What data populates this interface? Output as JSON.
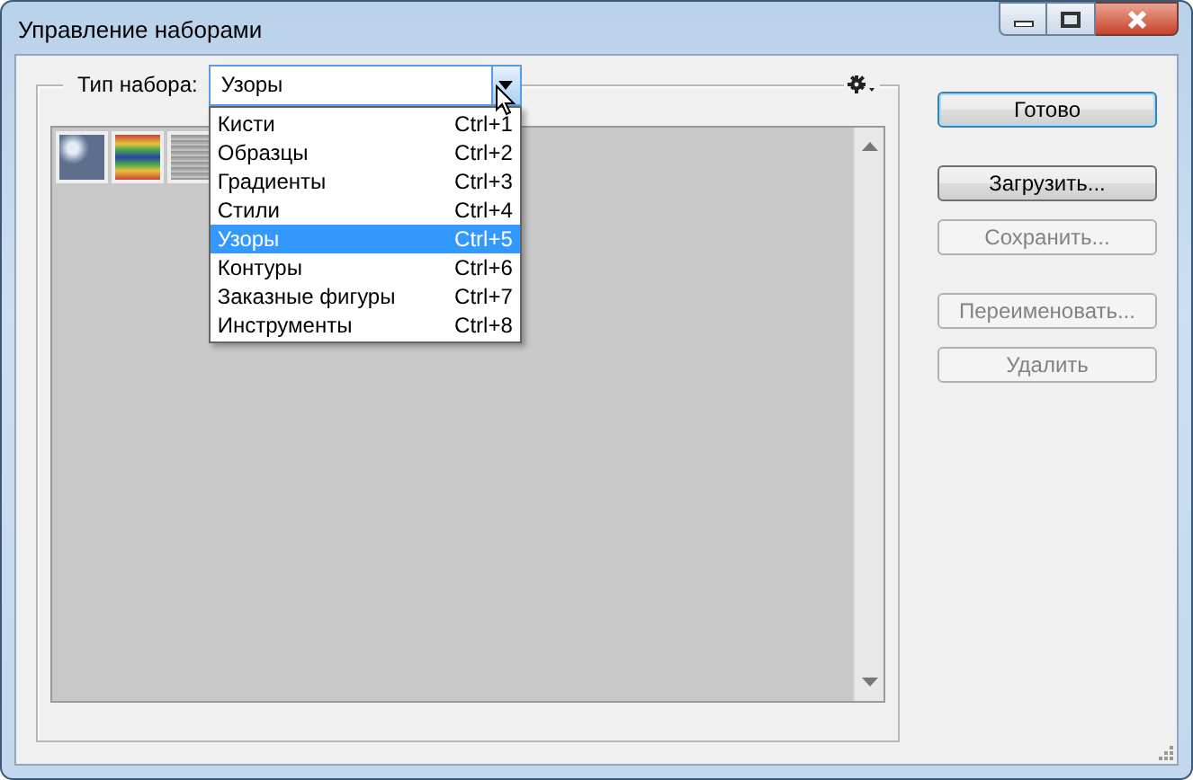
{
  "window": {
    "title": "Управление наборами"
  },
  "preset_type": {
    "label": "Тип набора:",
    "value": "Узоры",
    "expanded": true
  },
  "menu_items": [
    {
      "label": "Кисти",
      "shortcut": "Ctrl+1",
      "selected": false
    },
    {
      "label": "Образцы",
      "shortcut": "Ctrl+2",
      "selected": false
    },
    {
      "label": "Градиенты",
      "shortcut": "Ctrl+3",
      "selected": false
    },
    {
      "label": "Стили",
      "shortcut": "Ctrl+4",
      "selected": false
    },
    {
      "label": "Узоры",
      "shortcut": "Ctrl+5",
      "selected": true
    },
    {
      "label": "Контуры",
      "shortcut": "Ctrl+6",
      "selected": false
    },
    {
      "label": "Заказные фигуры",
      "shortcut": "Ctrl+7",
      "selected": false
    },
    {
      "label": "Инструменты",
      "shortcut": "Ctrl+8",
      "selected": false
    }
  ],
  "thumbnails": [
    {
      "kind": "bubbles"
    },
    {
      "kind": "rainbow"
    },
    {
      "kind": "noise"
    }
  ],
  "buttons": [
    {
      "label": "Готово",
      "default": true,
      "disabled": false
    },
    {
      "label": "Загрузить...",
      "default": false,
      "disabled": false
    },
    {
      "label": "Сохранить...",
      "default": false,
      "disabled": true
    },
    {
      "label": "Переименовать...",
      "default": false,
      "disabled": true
    },
    {
      "label": "Удалить",
      "default": false,
      "disabled": true
    }
  ]
}
